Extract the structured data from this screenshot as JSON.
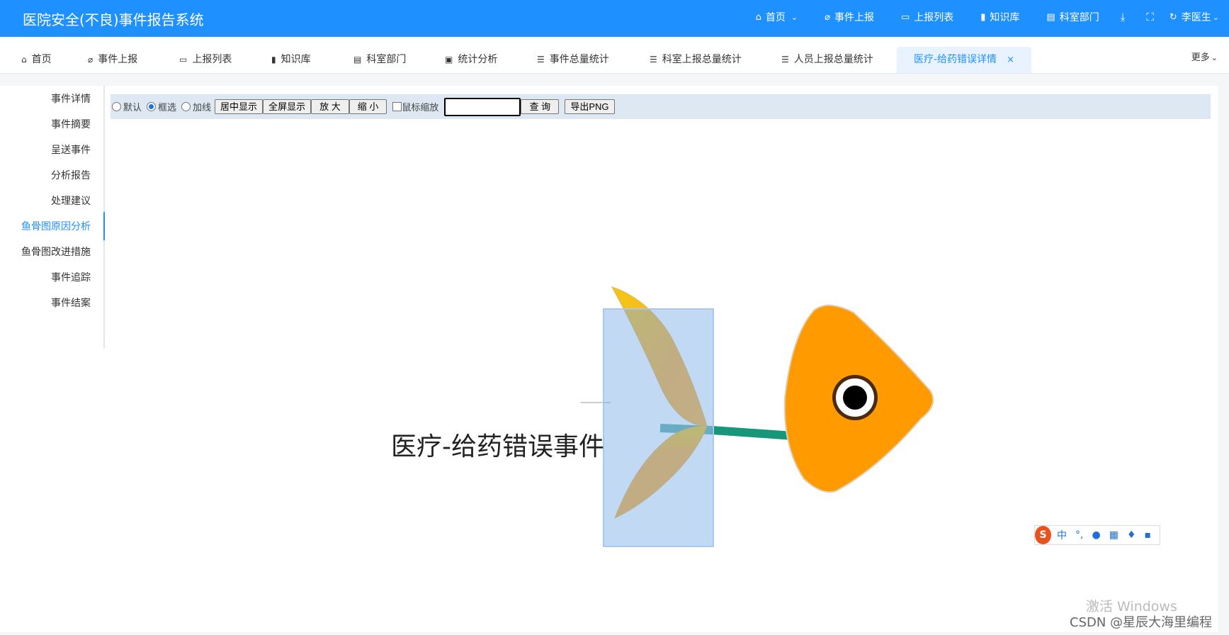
{
  "app": {
    "title": "医院安全(不良)事件报告系统"
  },
  "topnav": {
    "items": [
      {
        "label": "首页",
        "icon": "home-icon"
      },
      {
        "label": "事件上报",
        "icon": "paperclip-icon"
      },
      {
        "label": "上报列表",
        "icon": "monitor-icon"
      },
      {
        "label": "知识库",
        "icon": "book-icon"
      },
      {
        "label": "科室部门",
        "icon": "document-icon"
      }
    ],
    "user": "李医生"
  },
  "tabs": [
    {
      "label": "首页",
      "icon": "home-icon"
    },
    {
      "label": "事件上报",
      "icon": "paperclip-icon"
    },
    {
      "label": "上报列表",
      "icon": "monitor-icon"
    },
    {
      "label": "知识库",
      "icon": "book-icon"
    },
    {
      "label": "科室部门",
      "icon": "document-icon"
    },
    {
      "label": "统计分析",
      "icon": "chart-icon"
    },
    {
      "label": "事件总量统计",
      "icon": "list-icon"
    },
    {
      "label": "科室上报总量统计",
      "icon": "list-icon"
    },
    {
      "label": "人员上报总量统计",
      "icon": "list-icon"
    },
    {
      "label": "医疗-给药错误详情",
      "icon": "",
      "active": true
    }
  ],
  "more_label": "更多",
  "sidemenu": {
    "items": [
      "事件详情",
      "事件摘要",
      "呈送事件",
      "分析报告",
      "处理建议",
      "鱼骨图原因分析",
      "鱼骨图改进措施",
      "事件追踪",
      "事件结案"
    ],
    "active_index": 5
  },
  "toolbar": {
    "radios": [
      {
        "label": "默认",
        "checked": false
      },
      {
        "label": "框选",
        "checked": true
      },
      {
        "label": "加线",
        "checked": false
      }
    ],
    "center_button": "居中显示",
    "fullscreen_button": "全屏显示",
    "zoom_in_button": "放 大",
    "zoom_out_button": "缩 小",
    "mouse_zoom_label": "鼠标缩放",
    "search_value": "",
    "query_button": "查 询",
    "export_button": "导出PNG"
  },
  "diagram": {
    "title": "医疗-给药错误事件"
  },
  "ime": {
    "label": "中"
  },
  "watermark": "激活 Windows",
  "csdn": "CSDN @星辰大海里编程",
  "colors": {
    "primary": "#1e90ff",
    "fish_body": "#ff9a00",
    "fish_tail_top": "#f2c811",
    "spine": "#17977a"
  }
}
